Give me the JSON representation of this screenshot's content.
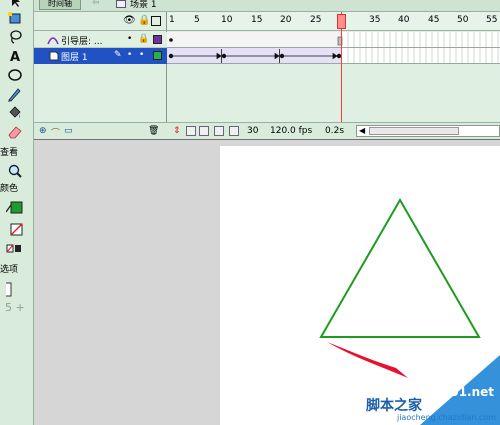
{
  "timeline": {
    "tab": "时间轴",
    "back_arrow": "⇦",
    "scene": "场景 1",
    "header_icons": {
      "eye": "eye-icon",
      "lock": "lock-icon",
      "outline": "outline-icon"
    },
    "layers": [
      {
        "name": "引导层: ...",
        "type": "guide",
        "color": "#7030a0",
        "selected": false
      },
      {
        "name": "图层 1",
        "type": "normal",
        "color": "#22b14c",
        "selected": true
      }
    ],
    "frame_ticks": [
      "1",
      "5",
      "10",
      "15",
      "20",
      "25",
      "30",
      "35",
      "40",
      "45",
      "50",
      "55"
    ],
    "current_frame": "30",
    "frame_rate": "120.0 fps",
    "elapsed": "0.2s"
  },
  "tools_panel": {
    "view_label": "查看",
    "colors_label": "颜色",
    "options_label": "选项",
    "tools": [
      "arrow-icon",
      "free-transform-icon",
      "lasso-icon",
      "text-icon",
      "oval-icon",
      "brush-icon",
      "paint-bucket-icon",
      "eraser-icon",
      "zoom-icon",
      "stroke-color-icon",
      "fill-color-icon",
      "swap-colors-icon"
    ]
  },
  "stage": {
    "background": "#ffffff",
    "triangle_stroke": "#1f9c1f",
    "arrow_color": "#e8102f"
  },
  "watermark": {
    "site": "jb51.net",
    "chars": "脚本之家",
    "sub": "jiaocheng.chazidian.com"
  }
}
